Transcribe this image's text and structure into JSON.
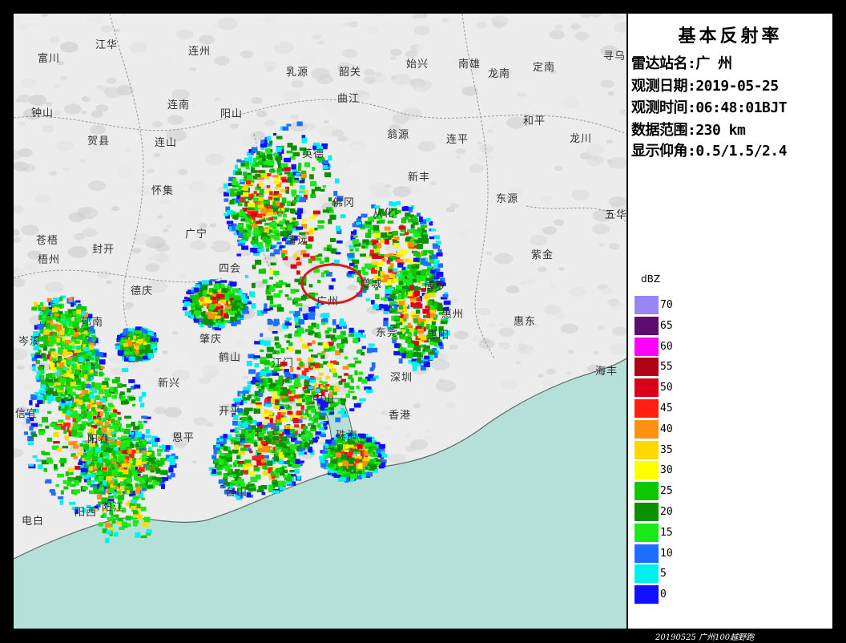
{
  "panel": {
    "title": "基本反射率",
    "station": "雷达站名:广 州",
    "date": "观测日期:2019-05-25",
    "time": "观测时间:06:48:01BJT",
    "range": "数据范围:230 km",
    "elevation": "显示仰角:0.5/1.5/2.4"
  },
  "legend": {
    "unit": "dBZ",
    "items": [
      {
        "label": "70",
        "color": "#9a86f0"
      },
      {
        "label": "65",
        "color": "#5c0e6e"
      },
      {
        "label": "60",
        "color": "#ff00ff"
      },
      {
        "label": "55",
        "color": "#b00018"
      },
      {
        "label": "50",
        "color": "#d9001a"
      },
      {
        "label": "45",
        "color": "#ff2010"
      },
      {
        "label": "40",
        "color": "#ff9010"
      },
      {
        "label": "35",
        "color": "#ffd800"
      },
      {
        "label": "30",
        "color": "#ffff00"
      },
      {
        "label": "25",
        "color": "#10c800"
      },
      {
        "label": "20",
        "color": "#0a9000"
      },
      {
        "label": "15",
        "color": "#1ae81a"
      },
      {
        "label": "10",
        "color": "#1e6eff"
      },
      {
        "label": "5",
        "color": "#00f0f0"
      },
      {
        "label": "0",
        "color": "#1010ff"
      }
    ]
  },
  "cities": [
    "富川",
    "江华",
    "连州",
    "乳源",
    "韶关",
    "始兴",
    "南雄",
    "龙南",
    "定南",
    "寻乌",
    "钟山",
    "连南",
    "阳山",
    "曲江",
    "翁源",
    "连平",
    "和平",
    "贺县",
    "连山",
    "英德",
    "新丰",
    "龙川",
    "怀集",
    "佛冈",
    "从化",
    "东源",
    "五华",
    "广宁",
    "苍梧",
    "梧州",
    "封开",
    "四会",
    "清远",
    "紫金",
    "德庆",
    "广州",
    "增城",
    "博罗",
    "惠州",
    "岑溪",
    "郁南",
    "肇庆",
    "新兴",
    "鹤山",
    "江门",
    "开平",
    "中山",
    "珠海",
    "东莞",
    "深圳",
    "惠阳",
    "海丰",
    "惠东",
    "香港",
    "信宜",
    "阳春",
    "阳江",
    "恩平",
    "台山",
    "电白",
    "阳西"
  ],
  "map": {
    "highlight": "广州",
    "sea_color": "#b4e0d8",
    "land_color": "#ececec"
  },
  "watermark": "20190525 广州100越野跑"
}
